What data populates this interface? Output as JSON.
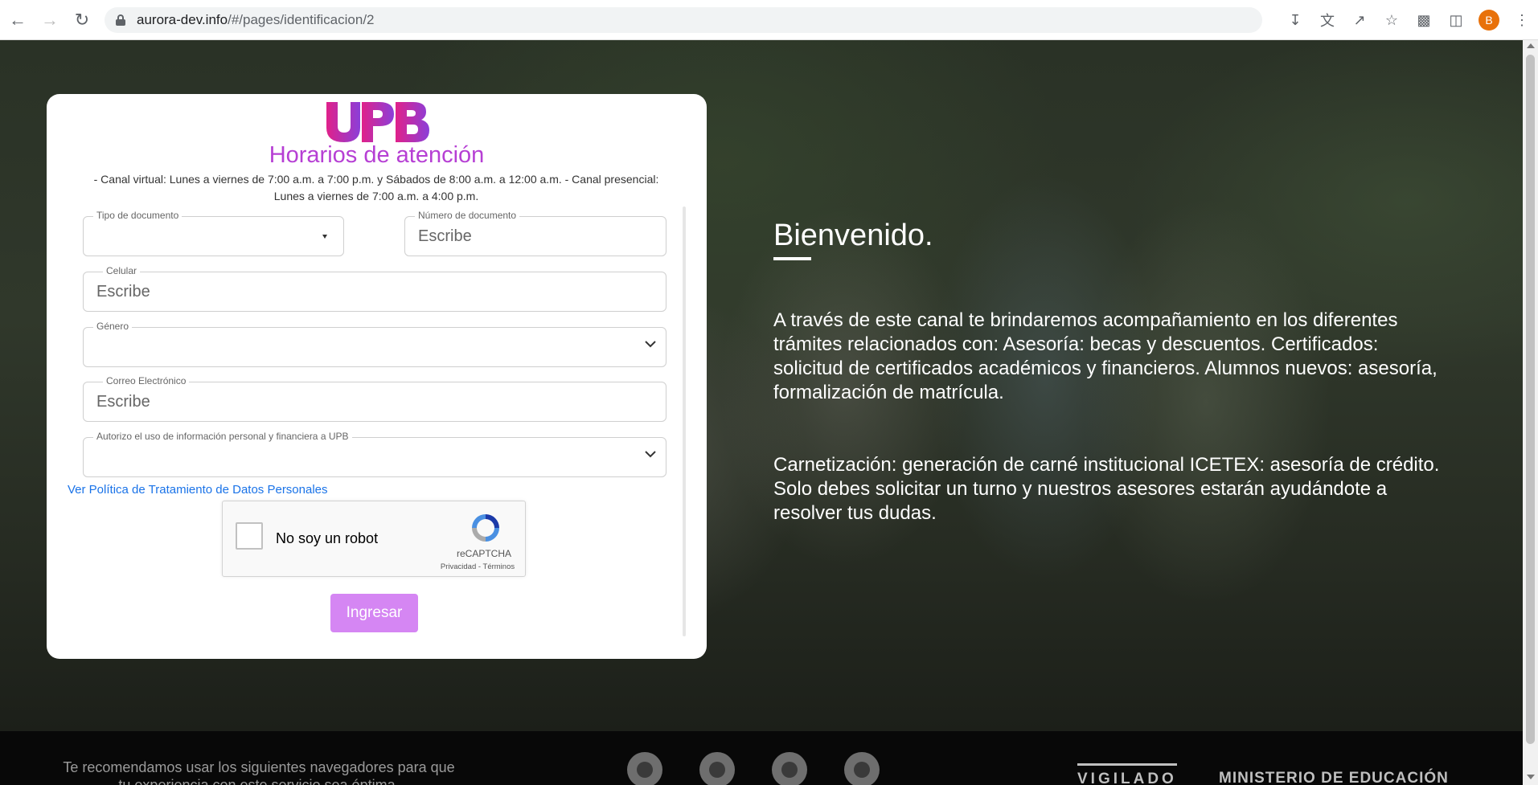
{
  "browser": {
    "url_host": "aurora-dev.info",
    "url_path": "/#/pages/identificacion/2",
    "avatar_letter": "B",
    "icons": [
      "back-icon",
      "forward-icon",
      "reload-icon",
      "lock-icon",
      "install-icon",
      "translate-icon",
      "share-icon",
      "bookmark-star-icon",
      "extensions-icon",
      "side-panel-icon",
      "menu-icon"
    ]
  },
  "card": {
    "title": "Horarios de atención",
    "hours": "- Canal virtual: Lunes a viernes de 7:00 a.m. a 7:00 p.m. y Sábados de 8:00 a.m. a 12:00 a.m. - Canal presencial: Lunes a viernes de 7:00 a.m. a 4:00 p.m.",
    "logo_text": "UPB",
    "brand_color": "#b63fd4",
    "fields": {
      "doc_type": {
        "label": "Tipo de documento",
        "value": ""
      },
      "doc_number": {
        "label": "Número de documento",
        "placeholder": "Escribe"
      },
      "phone": {
        "label": "Celular",
        "placeholder": "Escribe"
      },
      "gender": {
        "label": "Género",
        "value": ""
      },
      "email": {
        "label": "Correo Electrónico",
        "placeholder": "Escribe"
      },
      "consent": {
        "label": "Autorizo el uso de información personal y financiera a UPB",
        "value": ""
      }
    },
    "policy_link": "Ver Política de Tratamiento de Datos Personales",
    "captcha": {
      "label": "No soy un robot",
      "brand": "reCAPTCHA",
      "terms": "Privacidad - Términos"
    },
    "submit_label": "Ingresar",
    "submit_color": "#d586f3"
  },
  "welcome": {
    "heading": "Bienvenido.",
    "paragraph1": "A través de este canal te brindaremos acompañamiento en los diferentes trámites relacionados con: Asesoría: becas y descuentos. Certificados: solicitud de certificados académicos y financieros. Alumnos nuevos: asesoría, formalización de matrícula.",
    "paragraph2": "Carnetización: generación de carné institucional ICETEX: asesoría de crédito. Solo debes solicitar un turno y nuestros asesores estarán ayudándote a resolver tus dudas."
  },
  "footer": {
    "recommend": "Te recomendamos usar los siguientes navegadores para que tu experiencia con este servicio sea óptima.",
    "browsers": [
      "edge-icon",
      "chrome-icon",
      "firefox-icon",
      "safari-icon"
    ],
    "vigilado": "VIGILADO",
    "ministerio": "MINISTERIO DE EDUCACIÓN"
  }
}
